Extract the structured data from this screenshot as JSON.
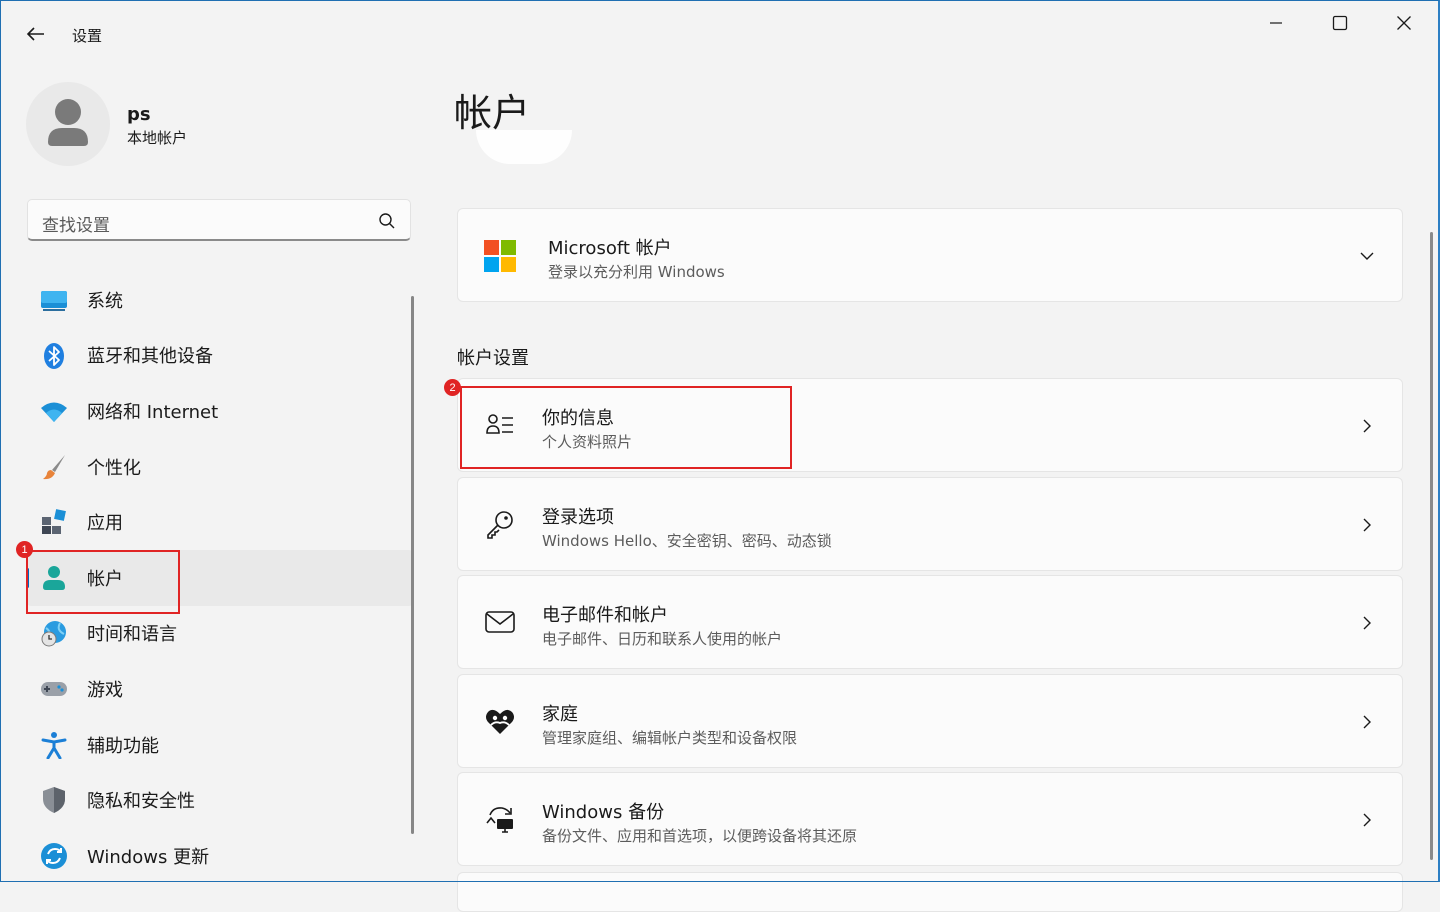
{
  "app": {
    "title": "设置"
  },
  "profile": {
    "name": "ps",
    "account_type": "本地帐户"
  },
  "search": {
    "placeholder": "查找设置"
  },
  "sidebar": {
    "items": [
      {
        "label": "系统",
        "icon": "system-icon"
      },
      {
        "label": "蓝牙和其他设备",
        "icon": "bluetooth-icon"
      },
      {
        "label": "网络和 Internet",
        "icon": "wifi-icon"
      },
      {
        "label": "个性化",
        "icon": "brush-icon"
      },
      {
        "label": "应用",
        "icon": "apps-icon"
      },
      {
        "label": "帐户",
        "icon": "account-icon",
        "active": true
      },
      {
        "label": "时间和语言",
        "icon": "globe-clock-icon"
      },
      {
        "label": "游戏",
        "icon": "gamepad-icon"
      },
      {
        "label": "辅助功能",
        "icon": "accessibility-icon"
      },
      {
        "label": "隐私和安全性",
        "icon": "shield-icon"
      },
      {
        "label": "Windows 更新",
        "icon": "update-icon"
      }
    ]
  },
  "main": {
    "title": "帐户",
    "microsoft_card": {
      "title": "Microsoft 帐户",
      "subtitle": "登录以充分利用 Windows"
    },
    "section_title": "帐户设置",
    "cards": [
      {
        "title": "你的信息",
        "subtitle": "个人资料照片",
        "icon": "person-info-icon"
      },
      {
        "title": "登录选项",
        "subtitle": "Windows Hello、安全密钥、密码、动态锁",
        "icon": "key-icon"
      },
      {
        "title": "电子邮件和帐户",
        "subtitle": "电子邮件、日历和联系人使用的帐户",
        "icon": "mail-icon"
      },
      {
        "title": "家庭",
        "subtitle": "管理家庭组、编辑帐户类型和设备权限",
        "icon": "family-heart-icon"
      },
      {
        "title": "Windows 备份",
        "subtitle": "备份文件、应用和首选项，以便跨设备将其还原",
        "icon": "backup-icon"
      }
    ]
  },
  "annotations": {
    "badge1": "1",
    "badge2": "2"
  },
  "colors": {
    "accent": "#0067c0",
    "annotation": "#e02424"
  }
}
